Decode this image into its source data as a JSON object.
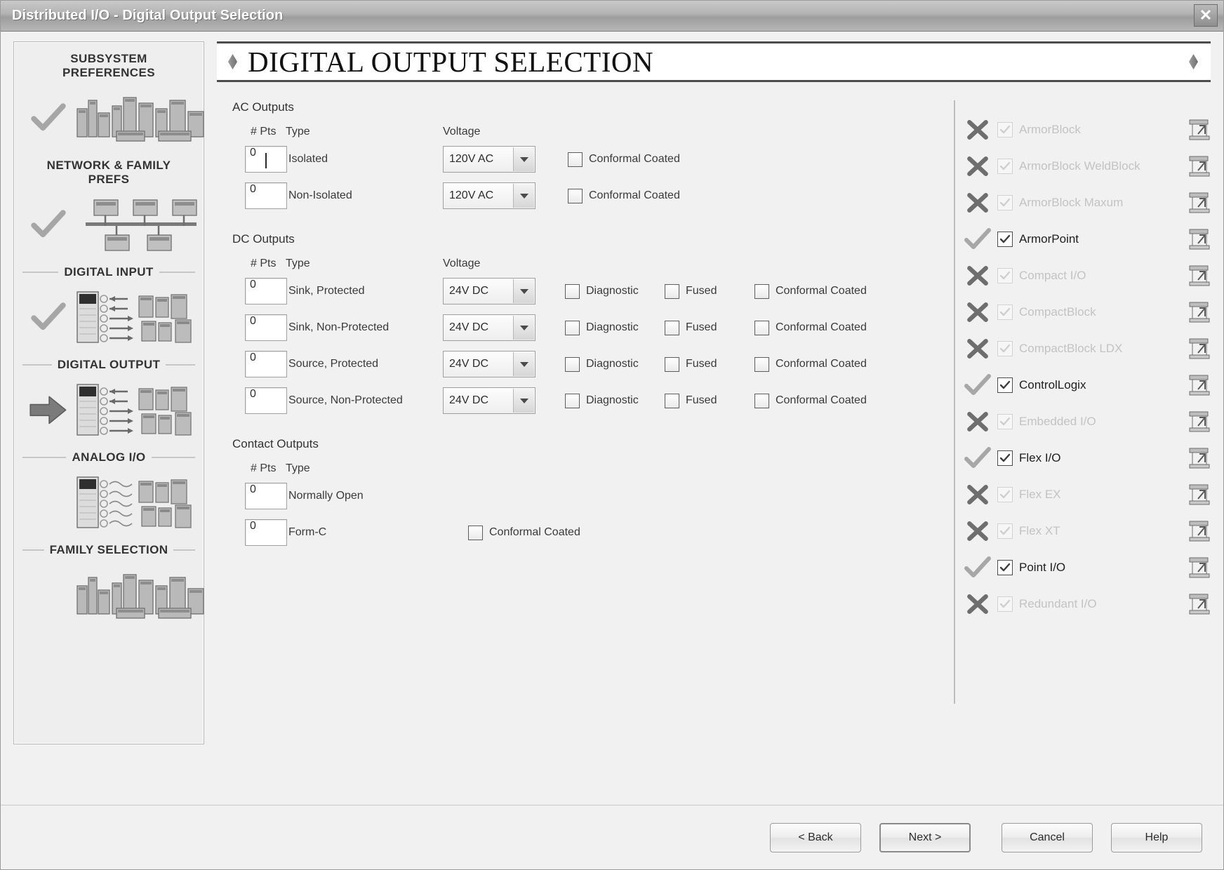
{
  "window": {
    "title": "Distributed I/O - Digital Output Selection",
    "close_label": "✕"
  },
  "banner": {
    "title": "DIGITAL OUTPUT SELECTION"
  },
  "sidebar": {
    "steps": [
      {
        "label": "SUBSYSTEM PREFERENCES",
        "state": "complete",
        "icon": "modules-group-icon"
      },
      {
        "label": "NETWORK & FAMILY PREFS",
        "state": "complete",
        "icon": "network-bus-icon"
      },
      {
        "label": "DIGITAL INPUT",
        "state": "complete",
        "icon": "digital-input-icon"
      },
      {
        "label": "DIGITAL OUTPUT",
        "state": "current",
        "icon": "digital-output-icon"
      },
      {
        "label": "ANALOG I/O",
        "state": "pending",
        "icon": "analog-io-icon"
      },
      {
        "label": "FAMILY SELECTION",
        "state": "pending",
        "icon": "family-selection-icon"
      }
    ]
  },
  "form": {
    "columns": {
      "pts": "# Pts",
      "type": "Type",
      "voltage": "Voltage"
    },
    "ac": {
      "title": "AC Outputs",
      "rows": [
        {
          "pts": "0",
          "type": "Isolated",
          "voltage": "120V AC",
          "focused": true,
          "conformal_label": "Conformal Coated",
          "conformal_checked": false
        },
        {
          "pts": "0",
          "type": "Non-Isolated",
          "voltage": "120V AC",
          "focused": false,
          "conformal_label": "Conformal Coated",
          "conformal_checked": false
        }
      ]
    },
    "dc": {
      "title": "DC Outputs",
      "rows": [
        {
          "pts": "0",
          "type": "Sink, Protected",
          "voltage": "24V DC",
          "diagnostic_label": "Diagnostic",
          "fused_label": "Fused",
          "conformal_label": "Conformal Coated"
        },
        {
          "pts": "0",
          "type": "Sink, Non-Protected",
          "voltage": "24V DC",
          "diagnostic_label": "Diagnostic",
          "fused_label": "Fused",
          "conformal_label": "Conformal Coated"
        },
        {
          "pts": "0",
          "type": "Source, Protected",
          "voltage": "24V DC",
          "diagnostic_label": "Diagnostic",
          "fused_label": "Fused",
          "conformal_label": "Conformal Coated"
        },
        {
          "pts": "0",
          "type": "Source, Non-Protected",
          "voltage": "24V DC",
          "diagnostic_label": "Diagnostic",
          "fused_label": "Fused",
          "conformal_label": "Conformal Coated"
        }
      ]
    },
    "contact": {
      "title": "Contact Outputs",
      "rows": [
        {
          "pts": "0",
          "type": "Normally Open",
          "conformal_label": "",
          "has_conformal": false
        },
        {
          "pts": "0",
          "type": "Form-C",
          "conformal_label": "Conformal Coated",
          "has_conformal": true
        }
      ]
    }
  },
  "families": [
    {
      "name": "ArmorBlock",
      "available": false,
      "checked": true
    },
    {
      "name": "ArmorBlock WeldBlock",
      "available": false,
      "checked": true
    },
    {
      "name": "ArmorBlock Maxum",
      "available": false,
      "checked": true
    },
    {
      "name": "ArmorPoint",
      "available": true,
      "checked": true
    },
    {
      "name": "Compact I/O",
      "available": false,
      "checked": true
    },
    {
      "name": "CompactBlock",
      "available": false,
      "checked": true
    },
    {
      "name": "CompactBlock LDX",
      "available": false,
      "checked": true
    },
    {
      "name": "ControlLogix",
      "available": true,
      "checked": true
    },
    {
      "name": "Embedded I/O",
      "available": false,
      "checked": true
    },
    {
      "name": "Flex I/O",
      "available": true,
      "checked": true
    },
    {
      "name": "Flex EX",
      "available": false,
      "checked": true
    },
    {
      "name": "Flex XT",
      "available": false,
      "checked": true
    },
    {
      "name": "Point I/O",
      "available": true,
      "checked": true
    },
    {
      "name": "Redundant I/O",
      "available": false,
      "checked": true
    }
  ],
  "footer": {
    "back": "< Back",
    "next": "Next >",
    "cancel": "Cancel",
    "help": "Help"
  }
}
